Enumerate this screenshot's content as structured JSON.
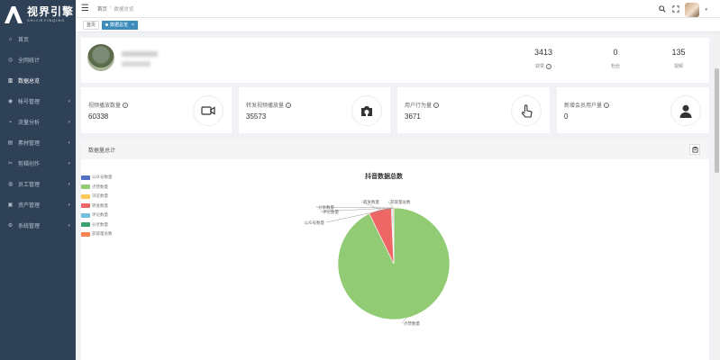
{
  "brand": {
    "name": "视界引擎",
    "sub": "SHIJIEYINQING"
  },
  "sidebar": {
    "items": [
      {
        "label": "首页",
        "icon": "home-icon",
        "active": false,
        "arrow": false
      },
      {
        "label": "全网统计",
        "icon": "globe-icon",
        "active": false,
        "arrow": false
      },
      {
        "label": "数据总览",
        "icon": "bar-chart-icon",
        "active": true,
        "arrow": false
      },
      {
        "label": "帐号管理",
        "icon": "user-icon",
        "active": false,
        "arrow": true
      },
      {
        "label": "流量分析",
        "icon": "signal-icon",
        "active": false,
        "arrow": true
      },
      {
        "label": "素材管理",
        "icon": "folder-icon",
        "active": false,
        "arrow": true
      },
      {
        "label": "剪辑创作",
        "icon": "scissors-icon",
        "active": false,
        "arrow": true
      },
      {
        "label": "员工管理",
        "icon": "team-icon",
        "active": false,
        "arrow": true
      },
      {
        "label": "资产管理",
        "icon": "wallet-icon",
        "active": false,
        "arrow": true
      },
      {
        "label": "系统管理",
        "icon": "gear-icon",
        "active": false,
        "arrow": true
      }
    ]
  },
  "topbar": {
    "breadcrumb": [
      "首页",
      "数据总览"
    ],
    "breadcrumb_sep": "/",
    "icons": [
      "search-icon",
      "fullscreen-icon",
      "avatar",
      "caret-down-icon"
    ]
  },
  "tags": {
    "home": "首页",
    "active": "数据总览",
    "close": "×"
  },
  "profile": {
    "stats": [
      {
        "value": "3413",
        "label": "获赞"
      },
      {
        "value": "0",
        "label": "粉丝"
      },
      {
        "value": "135",
        "label": "视频"
      }
    ]
  },
  "cards": [
    {
      "title": "视频播放数量",
      "value": "60338",
      "icon": "video-camera-icon"
    },
    {
      "title": "转发视频播放量",
      "value": "35573",
      "icon": "camera-icon"
    },
    {
      "title": "用户行为量",
      "value": "3671",
      "icon": "pointer-icon"
    },
    {
      "title": "新增会员用户量",
      "value": "0",
      "icon": "user-icon"
    }
  ],
  "chart_panel": {
    "header": "数据量总计",
    "btn_icon": "download-icon"
  },
  "chart_data": {
    "type": "pie",
    "title": "抖音数据总数",
    "legend_position": "left",
    "slices": [
      {
        "name": "公众号数量",
        "value": 0,
        "color": "#5470c6"
      },
      {
        "name": "点赞数量",
        "value": 3413,
        "color": "#91cc75"
      },
      {
        "name": "浏览数量",
        "value": 0,
        "color": "#fac858"
      },
      {
        "name": "转发数量",
        "value": 240,
        "color": "#ee6666"
      },
      {
        "name": "评论数量",
        "value": 12,
        "color": "#73c0de"
      },
      {
        "name": "分享数量",
        "value": 4,
        "color": "#3ba272"
      },
      {
        "name": "获取量总数",
        "value": 10,
        "color": "#fc8452"
      }
    ],
    "callouts": [
      "点赞数量",
      "转发数量",
      "获取量总数",
      "分享数量",
      "评论数量",
      "公众号数量"
    ]
  }
}
